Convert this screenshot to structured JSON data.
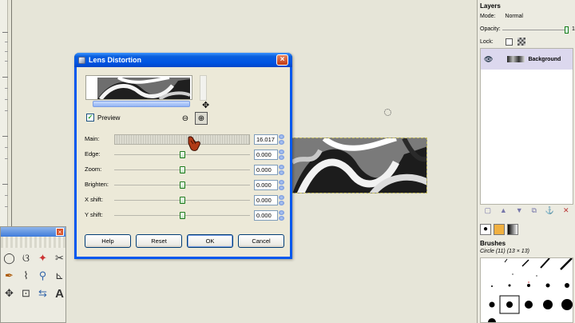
{
  "dialog": {
    "title": "Lens Distortion",
    "close_label": "×",
    "preview_label": "Preview",
    "sliders": [
      {
        "label": "Main:",
        "value": "16.017",
        "position": 0.61
      },
      {
        "label": "Edge:",
        "value": "0.000",
        "position": 0.5
      },
      {
        "label": "Zoom:",
        "value": "0.000",
        "position": 0.5
      },
      {
        "label": "Brighten:",
        "value": "0.000",
        "position": 0.5
      },
      {
        "label": "X shift:",
        "value": "0.000",
        "position": 0.5
      },
      {
        "label": "Y shift:",
        "value": "0.000",
        "position": 0.5
      }
    ],
    "buttons": {
      "help": "Help",
      "reset": "Reset",
      "ok": "OK",
      "cancel": "Cancel"
    }
  },
  "layers": {
    "title": "Layers",
    "mode_label": "Mode:",
    "mode_value": "Normal",
    "opacity_label": "Opacity:",
    "opacity_value": "1",
    "lock_label": "Lock:",
    "layer_name": "Background"
  },
  "brushes": {
    "title": "Brushes",
    "current": "Circle (11) (13 × 13)"
  },
  "toolbox": {
    "close_label": "×"
  },
  "colors": {
    "titlebar": "#0054e3",
    "canvas_bg": "#e6e5d8",
    "dialog_bg": "#ece9d8"
  }
}
